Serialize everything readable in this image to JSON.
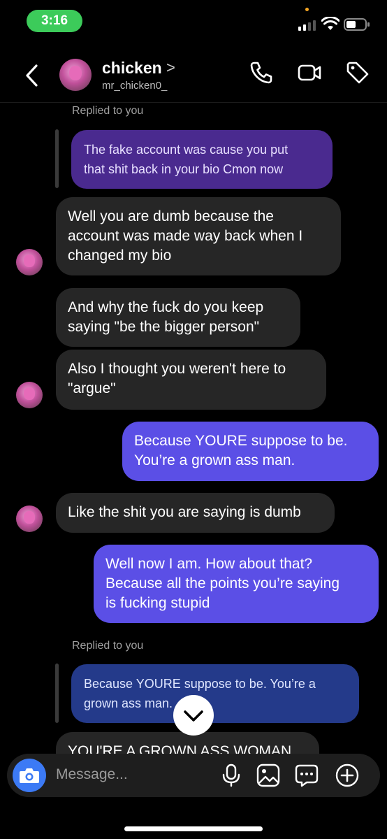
{
  "status_bar": {
    "time": "3:16"
  },
  "header": {
    "name": "chicken",
    "chevron": ">",
    "username": "mr_chicken0_"
  },
  "colors": {
    "sent": "#5b4fe6",
    "received": "#262626",
    "reply_purple": "#4a2a8f",
    "reply_blue": "#243a8a",
    "camera": "#3c7af5"
  },
  "icons": [
    "back-chevron-icon",
    "phone-icon",
    "video-camera-icon",
    "tag-icon",
    "camera-icon",
    "microphone-icon",
    "image-icon",
    "sticker-icon",
    "plus-circle-icon",
    "chevron-down-icon"
  ],
  "messages": {
    "reply1_label": "Replied to you",
    "reply1_lines": [
      "The fake account was cause you put",
      "that shit back in your bio Cmon now"
    ],
    "m1_lines": [
      "Well you are dumb because the",
      "account was made way back when I",
      "changed my bio"
    ],
    "m2_lines": [
      "And why the fuck do you keep",
      "saying \"be the bigger person\""
    ],
    "m3_lines": [
      "Also I thought you weren't here to",
      "\"argue\""
    ],
    "m4_lines": [
      "Because YOURE suppose to be.",
      "You’re a grown ass man."
    ],
    "m5_lines": [
      "Like the shit you are saying is dumb"
    ],
    "m6_lines": [
      "Well now I am. How about that?",
      "Because all the points you’re saying",
      "is fucking stupid"
    ],
    "reply2_label": "Replied to you",
    "reply2_lines": [
      "Because YOURE suppose to be. You’re a",
      "grown ass man."
    ],
    "m7_lines": [
      "YOU'RE A GROWN ASS WOMAN"
    ]
  },
  "composer": {
    "placeholder": "Message..."
  }
}
